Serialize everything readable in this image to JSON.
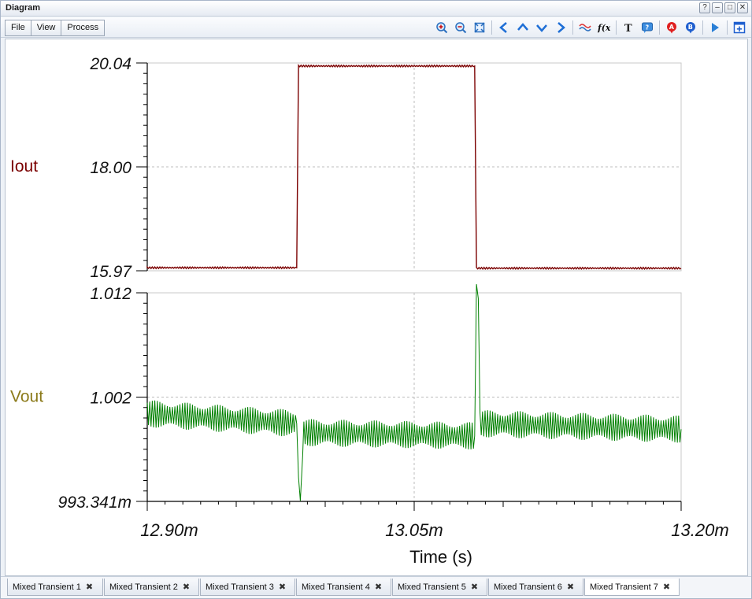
{
  "window": {
    "title": "Diagram"
  },
  "menu": [
    "File",
    "View",
    "Process"
  ],
  "window_buttons": [
    {
      "name": "help-button",
      "glyph": "?"
    },
    {
      "name": "minimize-button",
      "glyph": "–"
    },
    {
      "name": "maximize-button",
      "glyph": "□"
    },
    {
      "name": "close-button",
      "glyph": "✕"
    }
  ],
  "toolbar_icons": [
    "zoom-in-icon",
    "zoom-out-icon",
    "zoom-fit-icon",
    "arrow-left-icon",
    "arrow-up-icon",
    "arrow-down-icon",
    "arrow-right-icon",
    "waveform-icon",
    "function-icon",
    "text-icon",
    "help-icon",
    "cursor-a-icon",
    "cursor-b-icon",
    "play-icon",
    "add-panel-icon"
  ],
  "colors": {
    "iout": "#7b0000",
    "vout": "#008000",
    "vout_label": "#8b7a1a",
    "grid": "#bdbdbd"
  },
  "chart_data": [
    {
      "type": "line",
      "series": [
        {
          "name": "Iout",
          "x": [
            12.9,
            12.9,
            12.984,
            12.985,
            13.084,
            13.085,
            13.2
          ],
          "y": [
            16.01,
            16.03,
            16.03,
            19.98,
            19.98,
            16.02,
            16.02
          ]
        }
      ],
      "ylabel": "Iout",
      "y_ticks": [
        "20.04",
        "18.00",
        "15.97"
      ],
      "ylim": [
        15.97,
        20.04
      ],
      "xlim": [
        12.9,
        13.2
      ],
      "grid": true
    },
    {
      "type": "line",
      "series": [
        {
          "name": "Vout",
          "x": [
            12.9,
            12.984,
            12.985,
            12.986,
            12.988,
            13.084,
            13.085,
            13.086,
            13.087,
            13.2
          ],
          "y": [
            1.0012,
            1.0003,
            0.9955,
            0.9934,
            0.9995,
            0.9992,
            1.0118,
            1.0115,
            1.0003,
            0.9998
          ]
        }
      ],
      "ylabel": "Vout",
      "y_ticks": [
        "1.012",
        "1.002",
        "993.341m"
      ],
      "ylim": [
        0.993341,
        1.012
      ],
      "xlim": [
        12.9,
        13.2
      ],
      "grid": true
    }
  ],
  "x_axis": {
    "ticks": [
      "12.90m",
      "13.05m",
      "13.20m"
    ],
    "label": "Time (s)"
  },
  "tabs": [
    {
      "label": "Mixed Transient 1",
      "active": false
    },
    {
      "label": "Mixed Transient 2",
      "active": false
    },
    {
      "label": "Mixed Transient 3",
      "active": false
    },
    {
      "label": "Mixed Transient 4",
      "active": false
    },
    {
      "label": "Mixed Transient 5",
      "active": false
    },
    {
      "label": "Mixed Transient 6",
      "active": false
    },
    {
      "label": "Mixed Transient 7",
      "active": true
    }
  ]
}
